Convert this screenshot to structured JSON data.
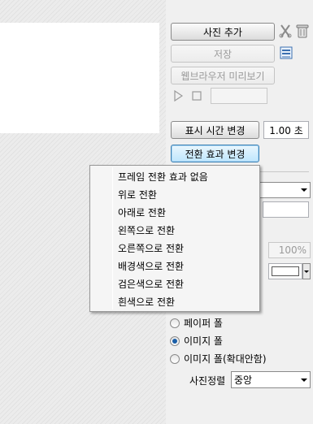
{
  "toolbar": {
    "add_photo_label": "사진 추가",
    "save_label": "저장",
    "browser_preview_label": "웹브라우저 미리보기"
  },
  "timing": {
    "change_display_time_label": "표시 시간 변경",
    "display_time_value": "1.00 초",
    "change_transition_label": "전환 효과 변경"
  },
  "transition_menu": {
    "items": [
      "프레임 전환 효과 없음",
      "위로 전환",
      "아래로 전환",
      "왼쪽으로 전환",
      "오른쪽으로 전환",
      "배경색으로 전환",
      "검은색으로 전환",
      "흰색으로 전환"
    ]
  },
  "background": {
    "scale_value": "100%",
    "options": [
      "페이퍼 폴",
      "이미지 폴",
      "이미지 폴(확대안함)"
    ],
    "selected_option": "이미지 폴",
    "align_label": "사진정렬",
    "align_value": "중앙"
  },
  "colors": {
    "selection_blue": "#1b5fa8",
    "focus_border": "#3c7fb1"
  },
  "icons": [
    "scissors-icon",
    "trash-can-icon",
    "list-view-icon",
    "play-icon",
    "stop-icon"
  ]
}
